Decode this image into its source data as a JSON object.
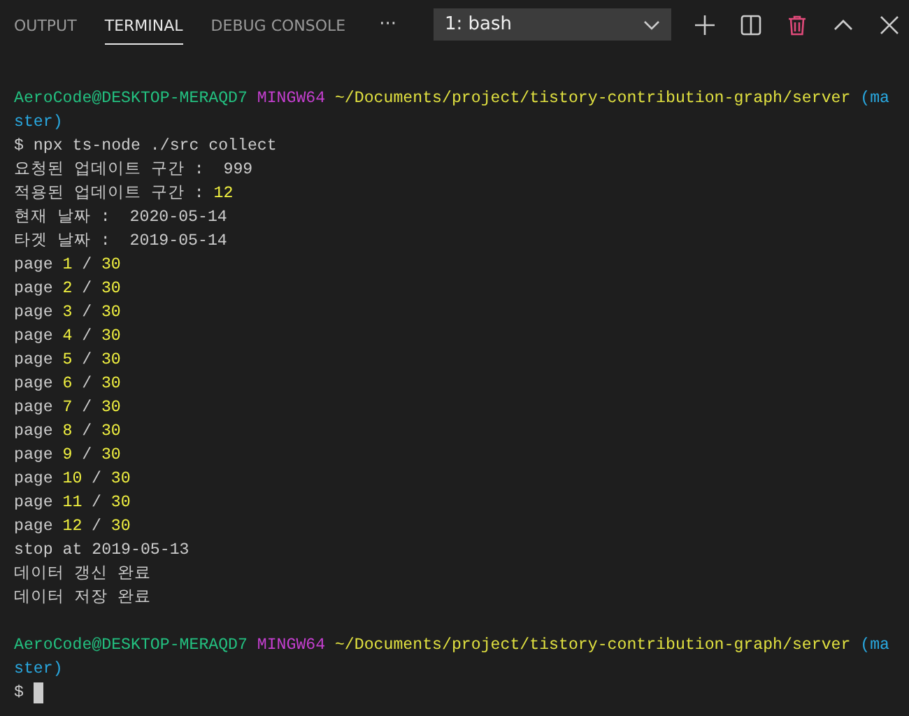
{
  "panel_tabs": [
    {
      "label": "OUTPUT",
      "selected": false
    },
    {
      "label": "TERMINAL",
      "selected": true
    },
    {
      "label": "DEBUG CONSOLE",
      "selected": false
    }
  ],
  "more_button": "···",
  "terminal_select": {
    "value": "1: bash"
  },
  "toolbar": [
    {
      "kind": "add"
    },
    {
      "kind": "split"
    },
    {
      "kind": "trash"
    },
    {
      "kind": "maximize"
    },
    {
      "kind": "close"
    }
  ],
  "terminal_lines": [
    {
      "segments": [
        {
          "kind": "user",
          "text": "AeroCode@DESKTOP-MERAQD7"
        },
        {
          "kind": "host",
          "text": "MINGW64"
        },
        {
          "kind": "path",
          "text": "~/Documents/project/tistory-contribution-graph/server"
        },
        {
          "kind": "branch",
          "text": "(ma"
        }
      ]
    },
    {
      "segments": [
        {
          "kind": "branch",
          "text": "ster)"
        }
      ]
    },
    {
      "segments": [
        {
          "kind": "plain",
          "text": "$ npx ts-node ./src collect"
        }
      ]
    },
    {
      "segments": [
        {
          "kind": "plain",
          "text": "요청된 업데이트 구간 :  999"
        }
      ]
    },
    {
      "segments": [
        {
          "kind": "plain",
          "text": "적용된 업데이트 구간 :"
        },
        {
          "kind": "number",
          "text": "12"
        }
      ]
    },
    {
      "segments": [
        {
          "kind": "plain",
          "text": "현재 날짜 :  2020-05-14"
        }
      ]
    },
    {
      "segments": [
        {
          "kind": "plain",
          "text": "타겟 날짜 :  2019-05-14"
        }
      ]
    },
    {
      "segments": [
        {
          "kind": "plain",
          "text": "page"
        },
        {
          "kind": "number",
          "text": "1"
        },
        {
          "kind": "plain",
          "text": "/"
        },
        {
          "kind": "number",
          "text": "30"
        }
      ]
    },
    {
      "segments": [
        {
          "kind": "plain",
          "text": "page"
        },
        {
          "kind": "number",
          "text": "2"
        },
        {
          "kind": "plain",
          "text": "/"
        },
        {
          "kind": "number",
          "text": "30"
        }
      ]
    },
    {
      "segments": [
        {
          "kind": "plain",
          "text": "page"
        },
        {
          "kind": "number",
          "text": "3"
        },
        {
          "kind": "plain",
          "text": "/"
        },
        {
          "kind": "number",
          "text": "30"
        }
      ]
    },
    {
      "segments": [
        {
          "kind": "plain",
          "text": "page"
        },
        {
          "kind": "number",
          "text": "4"
        },
        {
          "kind": "plain",
          "text": "/"
        },
        {
          "kind": "number",
          "text": "30"
        }
      ]
    },
    {
      "segments": [
        {
          "kind": "plain",
          "text": "page"
        },
        {
          "kind": "number",
          "text": "5"
        },
        {
          "kind": "plain",
          "text": "/"
        },
        {
          "kind": "number",
          "text": "30"
        }
      ]
    },
    {
      "segments": [
        {
          "kind": "plain",
          "text": "page"
        },
        {
          "kind": "number",
          "text": "6"
        },
        {
          "kind": "plain",
          "text": "/"
        },
        {
          "kind": "number",
          "text": "30"
        }
      ]
    },
    {
      "segments": [
        {
          "kind": "plain",
          "text": "page"
        },
        {
          "kind": "number",
          "text": "7"
        },
        {
          "kind": "plain",
          "text": "/"
        },
        {
          "kind": "number",
          "text": "30"
        }
      ]
    },
    {
      "segments": [
        {
          "kind": "plain",
          "text": "page"
        },
        {
          "kind": "number",
          "text": "8"
        },
        {
          "kind": "plain",
          "text": "/"
        },
        {
          "kind": "number",
          "text": "30"
        }
      ]
    },
    {
      "segments": [
        {
          "kind": "plain",
          "text": "page"
        },
        {
          "kind": "number",
          "text": "9"
        },
        {
          "kind": "plain",
          "text": "/"
        },
        {
          "kind": "number",
          "text": "30"
        }
      ]
    },
    {
      "segments": [
        {
          "kind": "plain",
          "text": "page"
        },
        {
          "kind": "number",
          "text": "10"
        },
        {
          "kind": "plain",
          "text": "/"
        },
        {
          "kind": "number",
          "text": "30"
        }
      ]
    },
    {
      "segments": [
        {
          "kind": "plain",
          "text": "page"
        },
        {
          "kind": "number",
          "text": "11"
        },
        {
          "kind": "plain",
          "text": "/"
        },
        {
          "kind": "number",
          "text": "30"
        }
      ]
    },
    {
      "segments": [
        {
          "kind": "plain",
          "text": "page"
        },
        {
          "kind": "number",
          "text": "12"
        },
        {
          "kind": "plain",
          "text": "/"
        },
        {
          "kind": "number",
          "text": "30"
        }
      ]
    },
    {
      "segments": [
        {
          "kind": "plain",
          "text": "stop at 2019-05-13"
        }
      ]
    },
    {
      "segments": [
        {
          "kind": "plain",
          "text": "데이터 갱신 완료"
        }
      ]
    },
    {
      "segments": [
        {
          "kind": "plain",
          "text": "데이터 저장 완료"
        }
      ]
    },
    {
      "blank_before": true,
      "segments": [
        {
          "kind": "user",
          "text": "AeroCode@DESKTOP-MERAQD7"
        },
        {
          "kind": "host",
          "text": "MINGW64"
        },
        {
          "kind": "path",
          "text": "~/Documents/project/tistory-contribution-graph/server"
        },
        {
          "kind": "branch",
          "text": "(ma"
        }
      ]
    },
    {
      "segments": [
        {
          "kind": "branch",
          "text": "ster)"
        }
      ]
    },
    {
      "segments": [
        {
          "kind": "plain",
          "text": "$"
        }
      ],
      "cursor": true
    }
  ]
}
